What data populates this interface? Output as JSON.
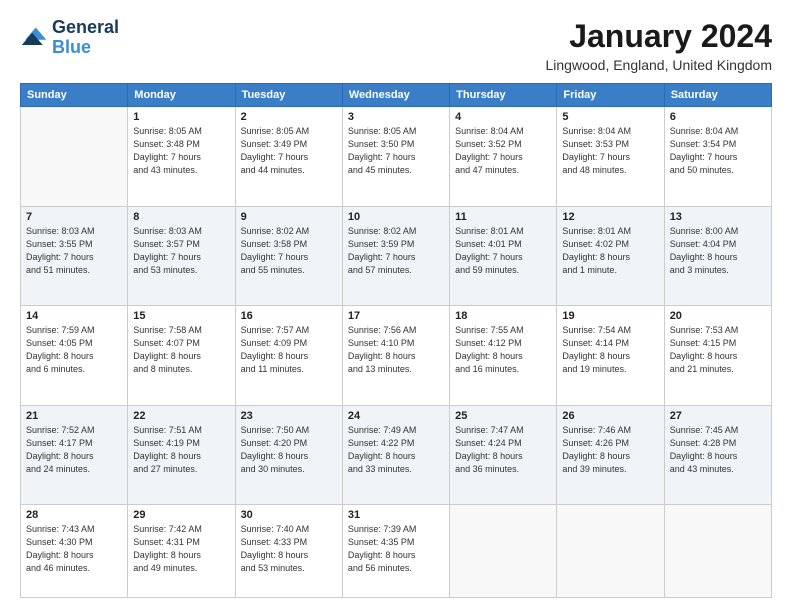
{
  "header": {
    "logo_line1": "General",
    "logo_line2": "Blue",
    "month": "January 2024",
    "location": "Lingwood, England, United Kingdom"
  },
  "days_of_week": [
    "Sunday",
    "Monday",
    "Tuesday",
    "Wednesday",
    "Thursday",
    "Friday",
    "Saturday"
  ],
  "weeks": [
    [
      {
        "day": "",
        "info": ""
      },
      {
        "day": "1",
        "info": "Sunrise: 8:05 AM\nSunset: 3:48 PM\nDaylight: 7 hours\nand 43 minutes."
      },
      {
        "day": "2",
        "info": "Sunrise: 8:05 AM\nSunset: 3:49 PM\nDaylight: 7 hours\nand 44 minutes."
      },
      {
        "day": "3",
        "info": "Sunrise: 8:05 AM\nSunset: 3:50 PM\nDaylight: 7 hours\nand 45 minutes."
      },
      {
        "day": "4",
        "info": "Sunrise: 8:04 AM\nSunset: 3:52 PM\nDaylight: 7 hours\nand 47 minutes."
      },
      {
        "day": "5",
        "info": "Sunrise: 8:04 AM\nSunset: 3:53 PM\nDaylight: 7 hours\nand 48 minutes."
      },
      {
        "day": "6",
        "info": "Sunrise: 8:04 AM\nSunset: 3:54 PM\nDaylight: 7 hours\nand 50 minutes."
      }
    ],
    [
      {
        "day": "7",
        "info": "Sunrise: 8:03 AM\nSunset: 3:55 PM\nDaylight: 7 hours\nand 51 minutes."
      },
      {
        "day": "8",
        "info": "Sunrise: 8:03 AM\nSunset: 3:57 PM\nDaylight: 7 hours\nand 53 minutes."
      },
      {
        "day": "9",
        "info": "Sunrise: 8:02 AM\nSunset: 3:58 PM\nDaylight: 7 hours\nand 55 minutes."
      },
      {
        "day": "10",
        "info": "Sunrise: 8:02 AM\nSunset: 3:59 PM\nDaylight: 7 hours\nand 57 minutes."
      },
      {
        "day": "11",
        "info": "Sunrise: 8:01 AM\nSunset: 4:01 PM\nDaylight: 7 hours\nand 59 minutes."
      },
      {
        "day": "12",
        "info": "Sunrise: 8:01 AM\nSunset: 4:02 PM\nDaylight: 8 hours\nand 1 minute."
      },
      {
        "day": "13",
        "info": "Sunrise: 8:00 AM\nSunset: 4:04 PM\nDaylight: 8 hours\nand 3 minutes."
      }
    ],
    [
      {
        "day": "14",
        "info": "Sunrise: 7:59 AM\nSunset: 4:05 PM\nDaylight: 8 hours\nand 6 minutes."
      },
      {
        "day": "15",
        "info": "Sunrise: 7:58 AM\nSunset: 4:07 PM\nDaylight: 8 hours\nand 8 minutes."
      },
      {
        "day": "16",
        "info": "Sunrise: 7:57 AM\nSunset: 4:09 PM\nDaylight: 8 hours\nand 11 minutes."
      },
      {
        "day": "17",
        "info": "Sunrise: 7:56 AM\nSunset: 4:10 PM\nDaylight: 8 hours\nand 13 minutes."
      },
      {
        "day": "18",
        "info": "Sunrise: 7:55 AM\nSunset: 4:12 PM\nDaylight: 8 hours\nand 16 minutes."
      },
      {
        "day": "19",
        "info": "Sunrise: 7:54 AM\nSunset: 4:14 PM\nDaylight: 8 hours\nand 19 minutes."
      },
      {
        "day": "20",
        "info": "Sunrise: 7:53 AM\nSunset: 4:15 PM\nDaylight: 8 hours\nand 21 minutes."
      }
    ],
    [
      {
        "day": "21",
        "info": "Sunrise: 7:52 AM\nSunset: 4:17 PM\nDaylight: 8 hours\nand 24 minutes."
      },
      {
        "day": "22",
        "info": "Sunrise: 7:51 AM\nSunset: 4:19 PM\nDaylight: 8 hours\nand 27 minutes."
      },
      {
        "day": "23",
        "info": "Sunrise: 7:50 AM\nSunset: 4:20 PM\nDaylight: 8 hours\nand 30 minutes."
      },
      {
        "day": "24",
        "info": "Sunrise: 7:49 AM\nSunset: 4:22 PM\nDaylight: 8 hours\nand 33 minutes."
      },
      {
        "day": "25",
        "info": "Sunrise: 7:47 AM\nSunset: 4:24 PM\nDaylight: 8 hours\nand 36 minutes."
      },
      {
        "day": "26",
        "info": "Sunrise: 7:46 AM\nSunset: 4:26 PM\nDaylight: 8 hours\nand 39 minutes."
      },
      {
        "day": "27",
        "info": "Sunrise: 7:45 AM\nSunset: 4:28 PM\nDaylight: 8 hours\nand 43 minutes."
      }
    ],
    [
      {
        "day": "28",
        "info": "Sunrise: 7:43 AM\nSunset: 4:30 PM\nDaylight: 8 hours\nand 46 minutes."
      },
      {
        "day": "29",
        "info": "Sunrise: 7:42 AM\nSunset: 4:31 PM\nDaylight: 8 hours\nand 49 minutes."
      },
      {
        "day": "30",
        "info": "Sunrise: 7:40 AM\nSunset: 4:33 PM\nDaylight: 8 hours\nand 53 minutes."
      },
      {
        "day": "31",
        "info": "Sunrise: 7:39 AM\nSunset: 4:35 PM\nDaylight: 8 hours\nand 56 minutes."
      },
      {
        "day": "",
        "info": ""
      },
      {
        "day": "",
        "info": ""
      },
      {
        "day": "",
        "info": ""
      }
    ]
  ]
}
